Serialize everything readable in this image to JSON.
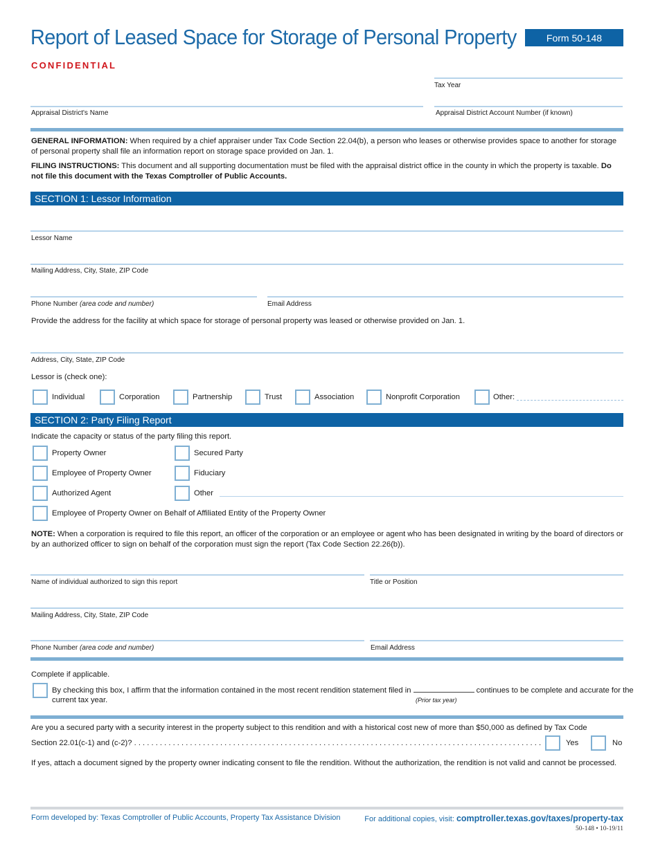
{
  "header": {
    "title": "Report of Leased Space for Storage of Personal Property",
    "form_badge": "Form 50-148",
    "confidential": "CONFIDENTIAL"
  },
  "top_fields": {
    "tax_year": "Tax Year",
    "district_name": "Appraisal District's Name",
    "account_number": "Appraisal District Account Number (if known)"
  },
  "general_info": {
    "label": "GENERAL INFORMATION:",
    "text": " When required by a chief appraiser under Tax Code Section 22.04(b), a person who leases or otherwise provides space to another for storage of personal property shall file an information report on storage space provided on Jan. 1."
  },
  "filing_instructions": {
    "label": "FILING INSTRUCTIONS:",
    "text": " This document and all supporting documentation must be filed with the appraisal district office in the county in which the property is taxable. ",
    "bold_tail": "Do not file this document with the Texas Comptroller of Public Accounts."
  },
  "section1": {
    "title": "SECTION 1: Lessor Information",
    "lessor_name": "Lessor Name",
    "mailing_address": "Mailing Address, City, State, ZIP Code",
    "phone_label": "Phone Number ",
    "phone_hint": "(area code and number)",
    "email": "Email Address",
    "facility_prompt": "Provide the address for the facility at which space for storage of personal property was leased or otherwise provided on Jan. 1.",
    "facility_address": "Address, City, State, ZIP Code",
    "lessor_is": "Lessor is (check one):",
    "lessor_types": [
      "Individual",
      "Corporation",
      "Partnership",
      "Trust",
      "Association",
      "Nonprofit Corporation",
      "Other:"
    ]
  },
  "section2": {
    "title": "SECTION 2: Party Filing Report",
    "prompt": "Indicate the capacity or status of the party filing this report.",
    "options_left": [
      "Property Owner",
      "Employee of Property Owner",
      "Authorized Agent"
    ],
    "options_right": [
      "Secured Party",
      "Fiduciary",
      "Other"
    ],
    "option_full": "Employee of Property Owner on Behalf of Affiliated Entity of the Property Owner",
    "note_label": "NOTE:",
    "note_text": " When a corporation is required to file this report, an officer of the corporation or an employee or agent who has been designated in writing by the board of directors or by an authorized officer to sign on behalf of the corporation must sign the report (Tax Code Section 22.26(b)).",
    "signer_name": "Name of individual authorized to sign this report",
    "title_position": "Title or Position",
    "mailing_address": "Mailing Address, City, State, ZIP Code",
    "phone_label": "Phone Number ",
    "phone_hint": "(area code and number)",
    "email": "Email Address"
  },
  "applicable": {
    "heading": "Complete if applicable.",
    "affirm_pre": "By checking this box, I affirm that the information contained in the most recent rendition statement filed in ",
    "affirm_post": " continues to be complete and accurate for the",
    "affirm_line2": "current tax year.",
    "prior_year_hint": "(Prior tax year)"
  },
  "secured": {
    "question_line1": "Are you a secured party with a security interest in the property subject to this rendition and with a historical cost new of more than $50,000 as defined by Tax Code",
    "question_line2": "Section 22.01(c-1) and (c-2)? . . . . . . . . . . . . . . . . . . . . . . . . . . . . . . . . . . . . . . . . . . . . . . . . . . . . . . . . . . . . . . . . . . . . . . . . . . . . . . . . . . . . . . . . . . . . . . . . . . . . . . . . . . . . . .",
    "yes": "Yes",
    "no": "No",
    "instruction": "If yes, attach a document signed by the property owner indicating consent to file the rendition. Without the authorization, the rendition is not valid and cannot be processed."
  },
  "footer": {
    "developed_by": "Form developed by: Texas Comptroller of Public Accounts, Property Tax Assistance Division",
    "copies_prefix": "For additional copies, visit: ",
    "copies_link": "comptroller.texas.gov/taxes/property-tax",
    "form_code": "50-148 • 10-19/11"
  }
}
